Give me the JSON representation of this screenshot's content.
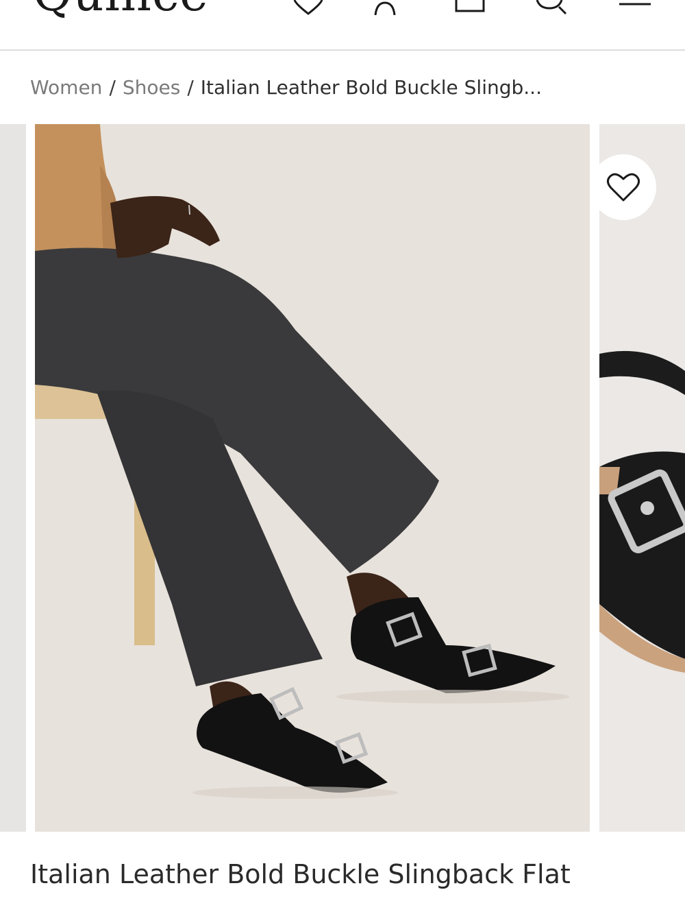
{
  "header": {
    "logo_text": "Quince",
    "icons": [
      "heart-icon",
      "account-icon",
      "bag-icon",
      "search-icon",
      "menu-icon"
    ]
  },
  "breadcrumb": {
    "items": [
      "Women",
      "Shoes"
    ],
    "current": "Italian Leather Bold Buckle Slingb..."
  },
  "product": {
    "title": "Italian Leather Bold Buckle Slingback Flat",
    "wishlist_icon": "heart-outline-icon"
  },
  "colors": {
    "background": "#ffffff",
    "divider": "#dcdcdc",
    "text_muted": "#7a7a7a",
    "text_primary": "#2a2a2a",
    "image_backdrop": "#e9e3de"
  }
}
